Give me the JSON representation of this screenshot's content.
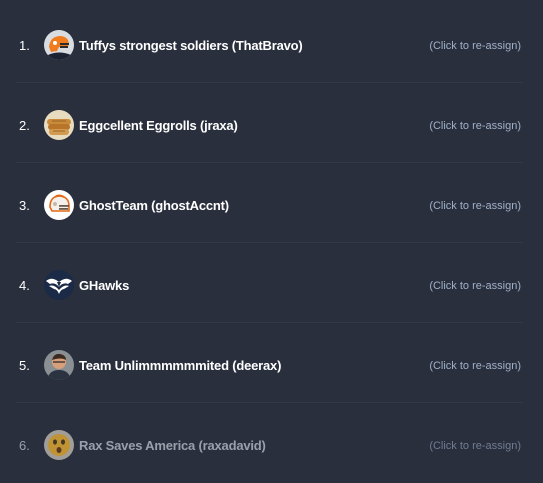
{
  "teams": [
    {
      "rank": "1.",
      "name": "Tuffys strongest soldiers (ThatBravo)",
      "action": "(Click to re-assign)",
      "avatar_icon": "football-helmet-avatar"
    },
    {
      "rank": "2.",
      "name": "Eggcellent Eggrolls (jraxa)",
      "action": "(Click to re-assign)",
      "avatar_icon": "eggroll-avatar"
    },
    {
      "rank": "3.",
      "name": "GhostTeam (ghostAccnt)",
      "action": "(Click to re-assign)",
      "avatar_icon": "helmet-avatar"
    },
    {
      "rank": "4.",
      "name": "GHawks",
      "action": "(Click to re-assign)",
      "avatar_icon": "hawk-logo-avatar"
    },
    {
      "rank": "5.",
      "name": "Team Unlimmmmmmited (deerax)",
      "action": "(Click to re-assign)",
      "avatar_icon": "person-photo-avatar"
    },
    {
      "rank": "6.",
      "name": "Rax Saves America (raxadavid)",
      "action": "(Click to re-assign)",
      "avatar_icon": "surprised-face-avatar"
    }
  ],
  "colors": {
    "background": "#2a2f3d",
    "separator": "#333949",
    "text": "#ffffff",
    "link": "#9fb0c8",
    "dimmed_text": "#9aa0ab"
  }
}
